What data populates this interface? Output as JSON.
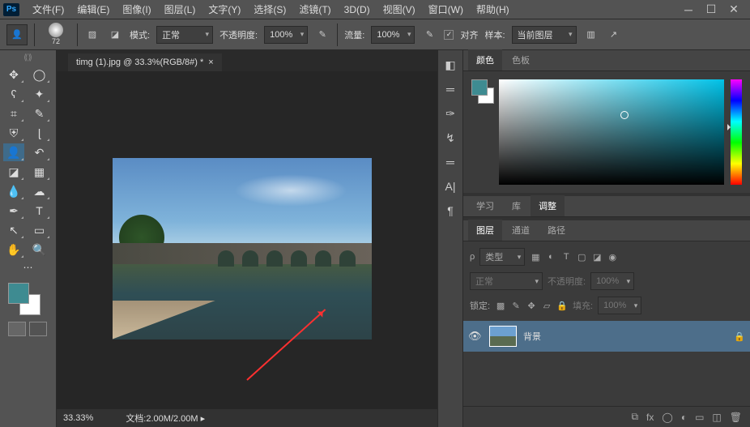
{
  "app": {
    "logo": "Ps"
  },
  "menus": [
    "文件(F)",
    "编辑(E)",
    "图像(I)",
    "图层(L)",
    "文字(Y)",
    "选择(S)",
    "滤镜(T)",
    "3D(D)",
    "视图(V)",
    "窗口(W)",
    "帮助(H)"
  ],
  "options": {
    "brush_size": "72",
    "mode_label": "模式:",
    "mode_value": "正常",
    "opacity_label": "不透明度:",
    "opacity_value": "100%",
    "flow_label": "流量:",
    "flow_value": "100%",
    "align_label": "对齐",
    "sample_label": "样本:",
    "sample_value": "当前图层"
  },
  "doc": {
    "tab_title": "timg (1).jpg @ 33.3%(RGB/8#) *",
    "zoom": "33.33%",
    "doc_label": "文档:",
    "doc_size": "2.00M/2.00M"
  },
  "panels": {
    "color_tab": "颜色",
    "swatch_tab": "色板",
    "learn_tab": "学习",
    "library_tab": "库",
    "adjust_tab": "调整",
    "layers_tab": "图层",
    "channels_tab": "通道",
    "paths_tab": "路径"
  },
  "layers": {
    "kind_label": "类型",
    "blend_value": "正常",
    "opacity_label": "不透明度:",
    "opacity_value": "100%",
    "lock_label": "锁定:",
    "fill_label": "填充:",
    "fill_value": "100%",
    "bg_layer_name": "背景"
  },
  "colors": {
    "foreground": "#3e8b91",
    "accent": "#4d6e8a"
  }
}
